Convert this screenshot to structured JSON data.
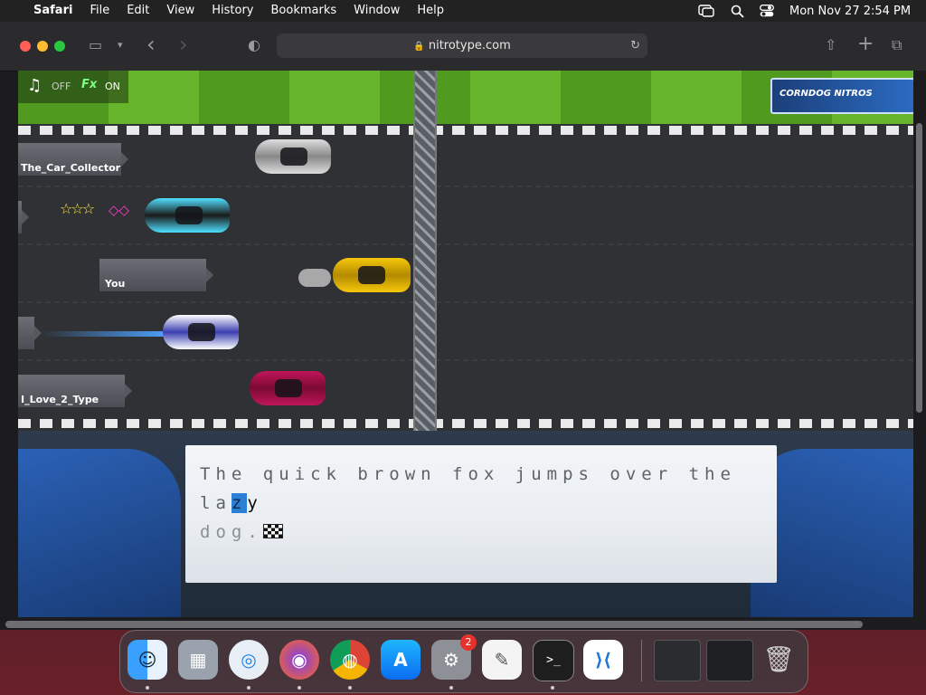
{
  "menubar": {
    "apple_glyph": "",
    "app_name": "Safari",
    "menus": [
      "File",
      "Edit",
      "View",
      "History",
      "Bookmarks",
      "Window",
      "Help"
    ],
    "datetime": "Mon Nov 27  2:54 PM"
  },
  "browser": {
    "url": "nitrotype.com",
    "lock_glyph": "🔒",
    "back_glyph": "‹",
    "forward_glyph": "›",
    "reload_glyph": "↻",
    "share_glyph": "⇧",
    "new_tab_glyph": "+",
    "tabs_glyph": "⧉",
    "sidebar_glyph": "▭",
    "shield_glyph": "◐"
  },
  "game": {
    "sound": {
      "music_glyph": "♫",
      "music_state": "OFF",
      "fx_label": "Fx",
      "fx_state": "ON"
    },
    "racers": [
      {
        "name": "The_Car_Collector"
      },
      {
        "name": ""
      },
      {
        "name": "You"
      },
      {
        "name": ""
      },
      {
        "name": "I_Love_2_Type"
      }
    ],
    "sponsor": "CORNDOG NITROS",
    "typing": {
      "typed": "The quick brown fox jumps over the la",
      "current": "z",
      "next": "y",
      "remaining_line2": "dog."
    }
  },
  "colors": {
    "accent_cursor": "#2b7fd4",
    "grass_dark": "#4f9a1f",
    "grass_light": "#66b52b",
    "road": "#2f3134"
  },
  "dock": {
    "apps": [
      "Finder",
      "Launchpad",
      "Safari",
      "Firefox",
      "Chrome",
      "App Store",
      "System Settings",
      "TextEdit",
      "Terminal",
      "Visual Studio Code",
      "Window Thumbnail 1",
      "Window Thumbnail 2",
      "Trash"
    ],
    "icons": [
      "finder-icon",
      "launchpad-icon",
      "safari-icon",
      "firefox-icon",
      "chrome-icon",
      "appstore-icon",
      "settings-icon",
      "textedit-icon",
      "terminal-icon",
      "vscode-icon",
      "window-thumb-icon",
      "window-thumb-icon",
      "trash-icon"
    ],
    "glyphs": [
      "☺",
      "▦",
      "◎",
      "◉",
      "◍",
      "A",
      "⚙",
      "✎",
      ">_",
      "⟩⟨",
      "",
      "",
      "🗑"
    ],
    "settings_badge": "2"
  }
}
